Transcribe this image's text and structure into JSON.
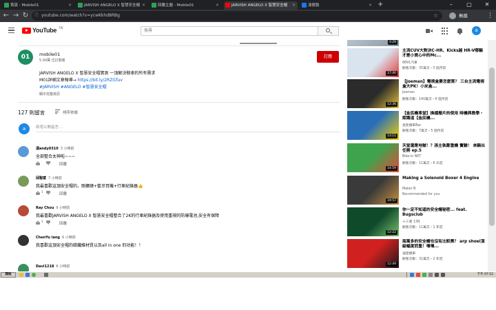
{
  "browser": {
    "tabs": [
      {
        "title": "首頁 - Mobile01",
        "favicon_color": "#2fa05a"
      },
      {
        "title": "JARVISH ANGELO X 智慧安全帽",
        "favicon_color": "#2fa05a"
      },
      {
        "title": "回覆主題 - Mobile01",
        "favicon_color": "#2fa05a"
      },
      {
        "title": "JARVISH ANGELO X 智慧安全帽",
        "favicon_color": "#ff0000"
      },
      {
        "title": "淺嘗臉",
        "favicon_color": "#1877f2"
      }
    ],
    "active_tab": 3,
    "url": "youtube.com/watch?v=ycwKkhd8RBg",
    "profile_label": "無痕",
    "new_tab": "+",
    "minimize": "–",
    "maximize": "▢",
    "close": "✕",
    "back": "←",
    "forward": "→",
    "reload": "↻",
    "tab_close": "×",
    "menu": "⋮",
    "star": "☆",
    "lock": "ⓘ"
  },
  "youtube": {
    "logo_text": "YouTube",
    "logo_cc": "TW",
    "search_placeholder": "搜尋",
    "user_initial": "a",
    "accent": "#ff0000"
  },
  "channel": {
    "avatar_text": "01",
    "name": "mobile01",
    "subscribers": "5.99萬 位訂閱者",
    "subscribe_label": "訂閱",
    "description": {
      "line1": "JARVISH ANGELO X 智慧安全帽實測 一頂解決騎車的所有需求",
      "line2_prefix": "M01詳細文章報導→ ",
      "line2_link": "https://bit.ly/2RZGTuv",
      "line3": "#JARVISH #ANGELO #智慧安全帽"
    },
    "show_more": "顯示完整資訊"
  },
  "comments_header": {
    "count": "127 則留言",
    "sort_label": "排序依據",
    "add_placeholder": "新增公開留言...",
    "user_initial": "a"
  },
  "comments": [
    {
      "author": "湯andy0310",
      "time": "3 小時前",
      "text": "全部整合太神啦~~~",
      "likes": "",
      "reply": "回覆",
      "avatar_color": "#5b9bd5"
    },
    {
      "author": "邱聖斌",
      "time": "7 小時前",
      "text": "我最喜歡這頂安全帽的，剛擴繞+藍牙耳機+行車紀錄器👍",
      "likes": "1",
      "reply": "回覆",
      "avatar_color": "#7a9a5a"
    },
    {
      "author": "Ray Chou",
      "time": "9 小時前",
      "text": "我最喜歡JARVISH ANGELO X 智慧安全帽整合了2K的行車紀錄器及使用重視的防爆電池,安全有保障",
      "likes": "1",
      "reply": "回覆",
      "avatar_color": "#b84a3a"
    },
    {
      "author": "ChenYu lang",
      "time": "6 小時前",
      "text": "我喜歡這頂安全帽的碳纖維材質以及all in one 的功能！！",
      "likes": "",
      "reply": "回覆",
      "avatar_color": "#333333"
    },
    {
      "author": "Davi1218",
      "time": "6 小時前",
      "text": "",
      "likes": "",
      "reply": "",
      "avatar_color": "#3a8f5a"
    }
  ],
  "recommendations": [
    {
      "title": "",
      "channel": "",
      "meta": "",
      "duration": "3:29",
      "thumb_colors": [
        "#c8d0d8",
        "#8a9aa8"
      ]
    },
    {
      "title": "主流CUV大對決C-HR、Kicks越 HR-V哪輛才是小資心中的Mc...",
      "channel": "8891汽車",
      "meta": "觀看次數：35萬次・5 個月前",
      "duration": "17:40",
      "thumb_colors": [
        "#d9e4ee",
        "#e23a3a"
      ]
    },
    {
      "title": "【Joeman】電視盒要怎麼買？ 三台主流電視盒大PK！小米盒...",
      "channel": "Joeman",
      "meta": "觀看次數：140萬次・6 個月前",
      "duration": "12:36",
      "thumb_colors": [
        "#2b2b2b",
        "#e6c23a"
      ]
    },
    {
      "title": "【金民機車堂】換檔撥片的使用 時機與教學・認識這【金民機...",
      "channel": "金民機車Bar",
      "meta": "觀看次數：7萬次・5 個月前",
      "duration": "13:11",
      "thumb_colors": [
        "#2a6fb6",
        "#f5d000"
      ]
    },
    {
      "title": "天堂還是地獄！？孫主執鄭重機 實驗！ 來騎出任務 ep.5",
      "channel": "Bike-in NET",
      "meta": "觀看次數：11萬次・6 天前",
      "duration": "14:59",
      "thumb_colors": [
        "#3fa34d",
        "#e24a3a"
      ]
    },
    {
      "title": "Making a Solenoid Boxer 4 Engine",
      "channel": "Maker B",
      "meta": "Recommended for you",
      "duration": "19:57",
      "thumb_colors": [
        "#3a3a3a",
        "#c89040"
      ]
    },
    {
      "title": "你一定不知道的安全帽秘密... feat. Bugsclub",
      "channel": "十三重 13N",
      "meta": "觀看次數：11萬次・1 年前",
      "duration": "12:22",
      "thumb_colors": [
        "#0f4a2a",
        "#7ac070"
      ]
    },
    {
      "title": "兩萬多的安全帽也沒有比較黑？ arp shoei頂級幅度而重！嘿嘿...",
      "channel": "滷蛋機車",
      "meta": "觀看次數：31萬次・2 年前",
      "duration": "12:49",
      "thumb_colors": [
        "#d02020",
        "#1a1a1a"
      ]
    }
  ],
  "taskbar": {
    "start_label": "開始",
    "clock": "下午 07:52"
  }
}
